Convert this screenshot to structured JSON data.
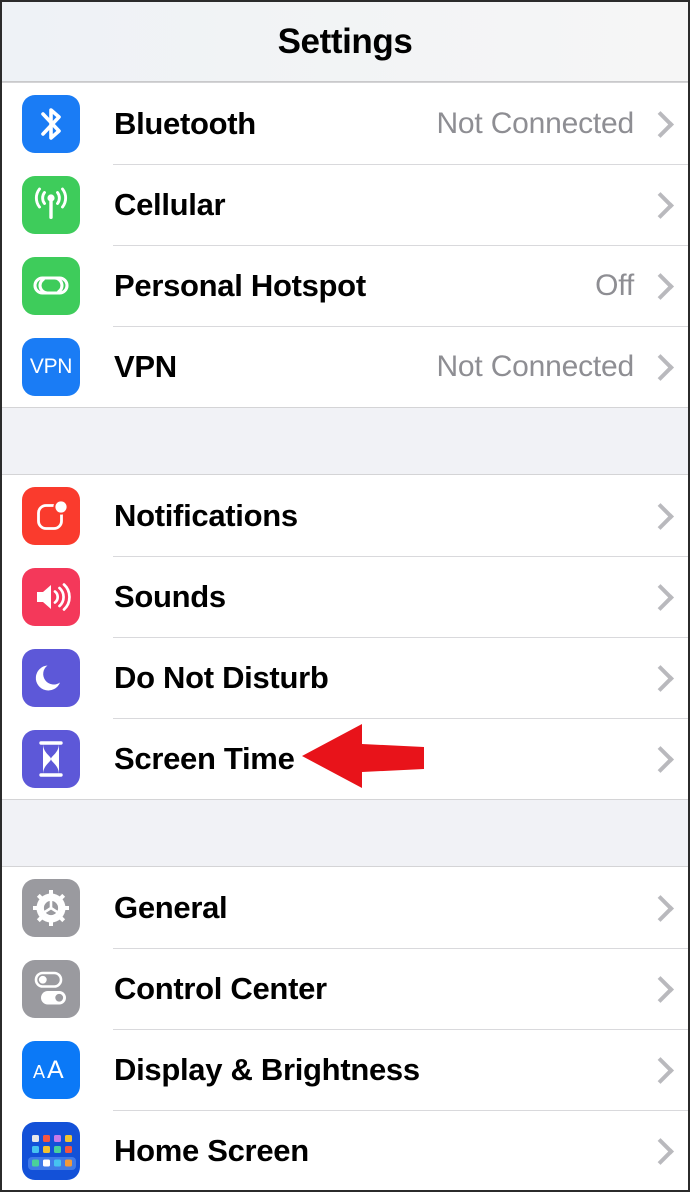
{
  "header": {
    "title": "Settings"
  },
  "groups": [
    {
      "id": "connectivity",
      "rows": [
        {
          "label": "Bluetooth",
          "value": "Not Connected",
          "icon": "bluetooth-icon",
          "chevron": "chevron-right-icon"
        },
        {
          "label": "Cellular",
          "value": "",
          "icon": "cellular-antenna-icon",
          "chevron": "chevron-right-icon"
        },
        {
          "label": "Personal Hotspot",
          "value": "Off",
          "icon": "hotspot-link-icon",
          "chevron": "chevron-right-icon"
        },
        {
          "label": "VPN",
          "value": "Not Connected",
          "icon": "vpn-icon",
          "chevron": "chevron-right-icon"
        }
      ]
    },
    {
      "id": "alerts",
      "rows": [
        {
          "label": "Notifications",
          "value": "",
          "icon": "notifications-badge-icon",
          "chevron": "chevron-right-icon"
        },
        {
          "label": "Sounds",
          "value": "",
          "icon": "speaker-waves-icon",
          "chevron": "chevron-right-icon"
        },
        {
          "label": "Do Not Disturb",
          "value": "",
          "icon": "moon-icon",
          "chevron": "chevron-right-icon"
        },
        {
          "label": "Screen Time",
          "value": "",
          "icon": "hourglass-icon",
          "chevron": "chevron-right-icon"
        }
      ]
    },
    {
      "id": "system",
      "rows": [
        {
          "label": "General",
          "value": "",
          "icon": "gear-icon",
          "chevron": "chevron-right-icon"
        },
        {
          "label": "Control Center",
          "value": "",
          "icon": "toggles-icon",
          "chevron": "chevron-right-icon"
        },
        {
          "label": "Display & Brightness",
          "value": "",
          "icon": "aa-text-size-icon",
          "chevron": "chevron-right-icon"
        },
        {
          "label": "Home Screen",
          "value": "",
          "icon": "app-grid-icon",
          "chevron": "chevron-right-icon"
        }
      ]
    }
  ],
  "annotation": {
    "type": "arrow-left",
    "name": "red-arrow-annotation",
    "points_to": "Screen Time",
    "color": "#e8131a"
  },
  "colors": {
    "bluetooth_blue": "#1a7cf5",
    "cellular_green": "#3ecc5b",
    "hotspot_green": "#3ecc5b",
    "vpn_blue": "#1a7cf5",
    "notifications_red": "#fa3b2d",
    "sounds_pink": "#f4385a",
    "dnd_indigo": "#5d58d8",
    "screentime_indigo": "#5d58d8",
    "general_gray": "#9a9a9f",
    "controlcenter_gray": "#9a9a9f",
    "display_blue": "#0b79f7",
    "homescreen_blue": "#1351d8",
    "value_text": "#8e8e93",
    "separator": "#d9d9dc",
    "group_gap": "#f1f2f6",
    "nav_background": "#f1f3f5"
  }
}
